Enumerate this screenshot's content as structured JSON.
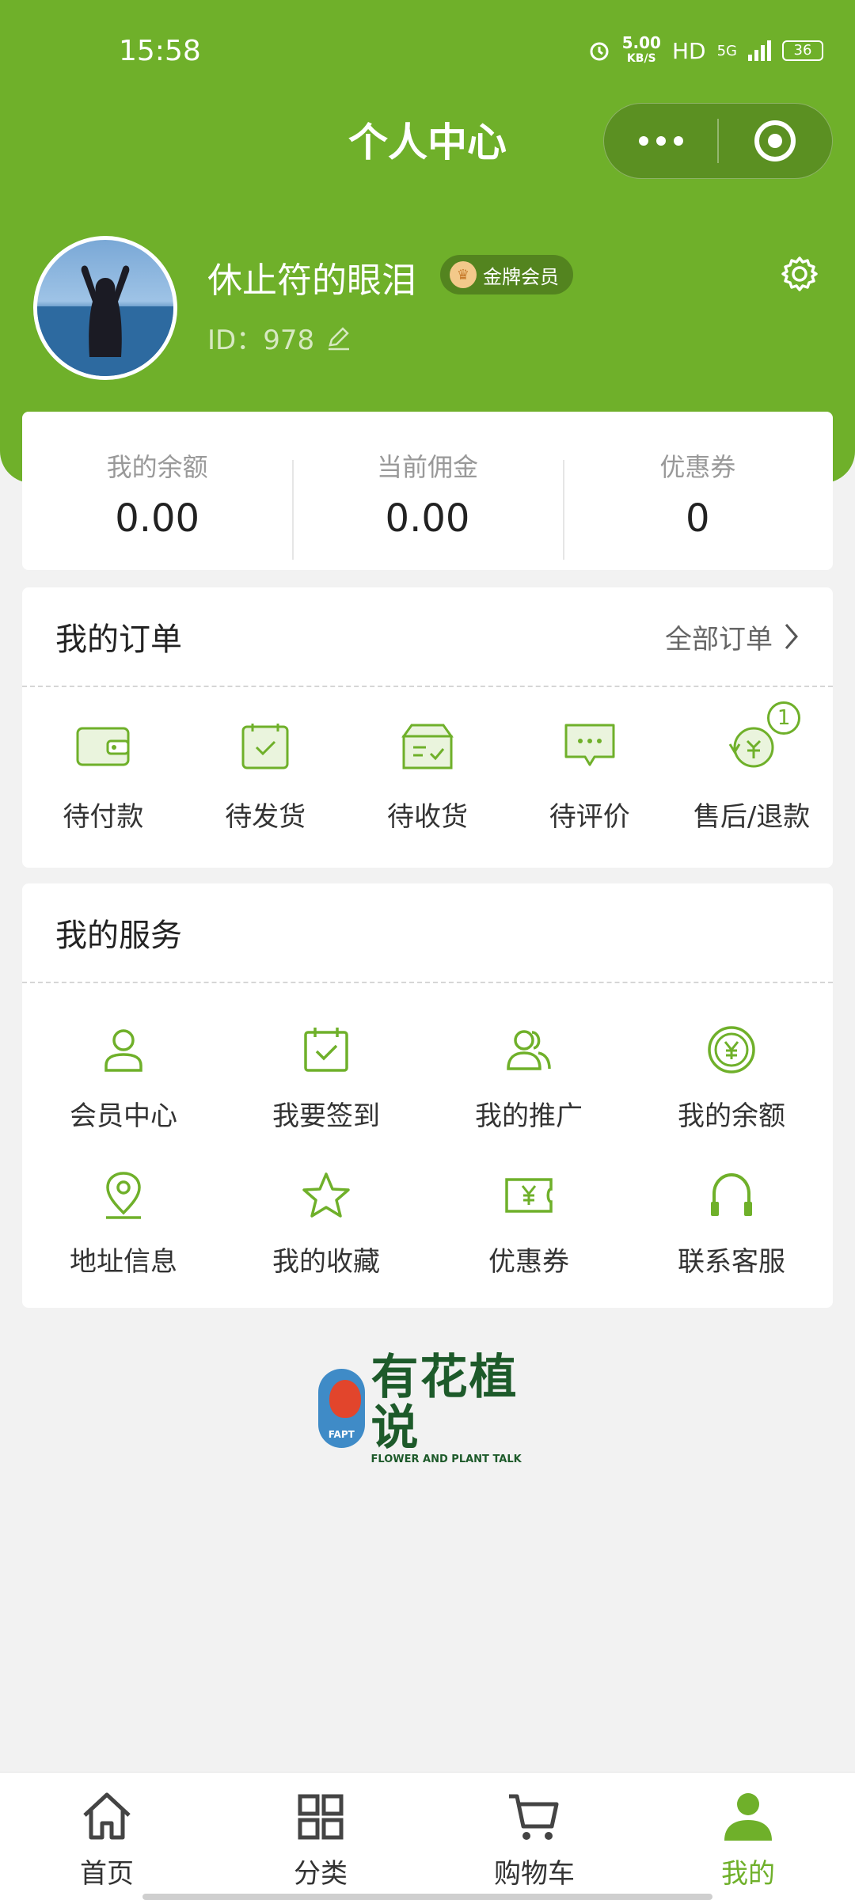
{
  "status_bar": {
    "time": "15:58",
    "speed_value": "5.00",
    "speed_unit": "KB/S",
    "hd": "HD",
    "network": "5G",
    "battery": "36"
  },
  "nav": {
    "title": "个人中心"
  },
  "profile": {
    "username": "休止符的眼泪",
    "member_level": "金牌会员",
    "id_text": "ID：978"
  },
  "stats": [
    {
      "label": "我的余额",
      "value": "0.00"
    },
    {
      "label": "当前佣金",
      "value": "0.00"
    },
    {
      "label": "优惠券",
      "value": "0"
    }
  ],
  "orders": {
    "title": "我的订单",
    "all_label": "全部订单",
    "items": [
      {
        "label": "待付款",
        "icon": "wallet-icon"
      },
      {
        "label": "待发货",
        "icon": "calendar-check-icon"
      },
      {
        "label": "待收货",
        "icon": "box-icon"
      },
      {
        "label": "待评价",
        "icon": "chat-icon"
      },
      {
        "label": "售后/退款",
        "icon": "refund-icon",
        "badge": "1"
      }
    ]
  },
  "services": {
    "title": "我的服务",
    "items": [
      {
        "label": "会员中心",
        "icon": "user-icon"
      },
      {
        "label": "我要签到",
        "icon": "calendar-check-icon"
      },
      {
        "label": "我的推广",
        "icon": "users-icon"
      },
      {
        "label": "我的余额",
        "icon": "yen-coin-icon"
      },
      {
        "label": "地址信息",
        "icon": "location-icon"
      },
      {
        "label": "我的收藏",
        "icon": "star-icon"
      },
      {
        "label": "优惠券",
        "icon": "coupon-icon"
      },
      {
        "label": "联系客服",
        "icon": "headset-icon"
      }
    ]
  },
  "logo": {
    "cn": "有花植说",
    "en": "FLOWER AND PLANT TALK",
    "badge_text": "FAPT"
  },
  "tabbar": [
    {
      "label": "首页",
      "icon": "home-icon"
    },
    {
      "label": "分类",
      "icon": "grid-icon"
    },
    {
      "label": "购物车",
      "icon": "cart-icon"
    },
    {
      "label": "我的",
      "icon": "person-icon",
      "active": true
    }
  ],
  "colors": {
    "brand": "#6fb02a",
    "background": "#f2f2f2"
  }
}
